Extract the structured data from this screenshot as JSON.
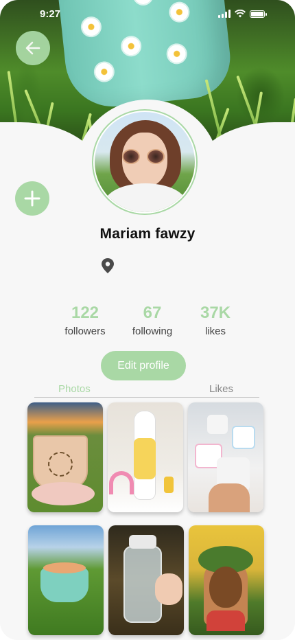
{
  "status_bar": {
    "time": "9:27"
  },
  "profile": {
    "name": "Mariam fawzy"
  },
  "stats": [
    {
      "value": "122",
      "label": "followers"
    },
    {
      "value": "67",
      "label": "following"
    },
    {
      "value": "37K",
      "label": "likes"
    }
  ],
  "actions": {
    "edit_profile": "Edit profile"
  },
  "tabs": {
    "photos": "Photos",
    "likes": "Likes",
    "active": "Photos"
  },
  "colors": {
    "accent": "#a9d8a5",
    "background": "#f7f7f7",
    "text": "#111111"
  },
  "icons": {
    "back": "arrow-left-icon",
    "add": "plus-icon",
    "location": "location-pin-icon",
    "signal": "cellular-signal-icon",
    "wifi": "wifi-icon",
    "battery": "battery-icon"
  },
  "grid": [
    {
      "subject": "painted sun pot"
    },
    {
      "subject": "painted bottle"
    },
    {
      "subject": "succulent pots"
    },
    {
      "subject": "teal flower pot"
    },
    {
      "subject": "water bottle"
    },
    {
      "subject": "face planter"
    }
  ]
}
